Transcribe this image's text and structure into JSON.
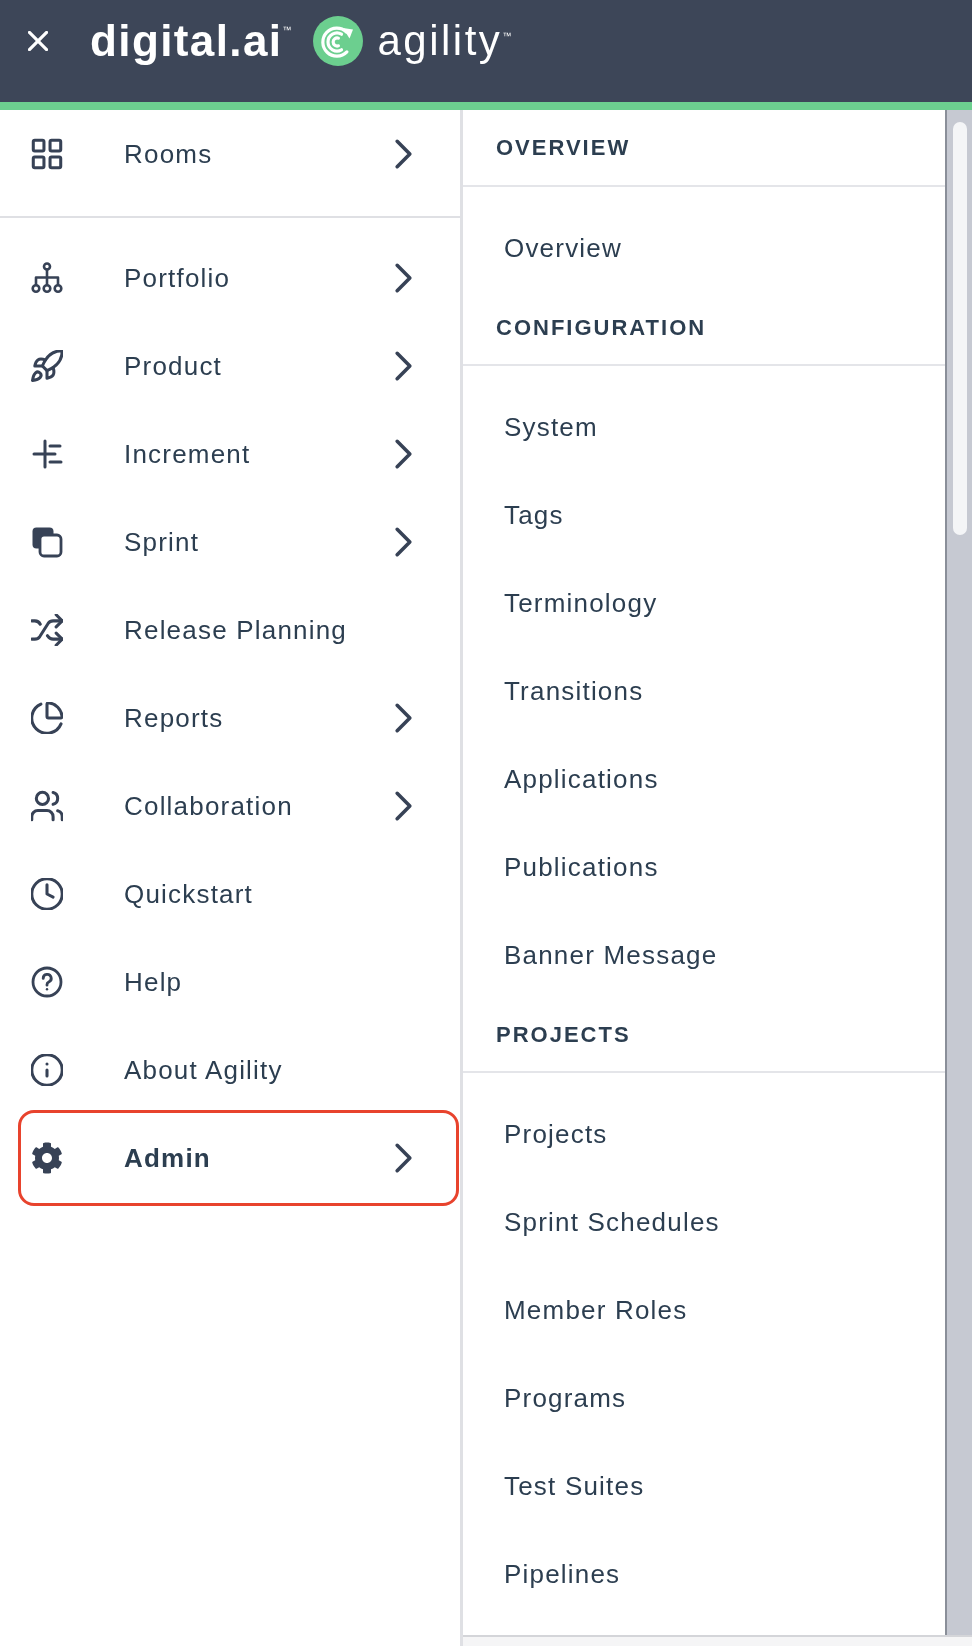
{
  "header": {
    "logo": {
      "brand": "digital.ai",
      "brand_mark": "™",
      "product": "agility",
      "product_mark": "™"
    }
  },
  "sidebar": {
    "sections": [
      {
        "items": [
          {
            "label": "Rooms",
            "has_submenu": true,
            "selected": false
          }
        ]
      },
      {
        "items": [
          {
            "label": "Portfolio",
            "has_submenu": true,
            "selected": false
          },
          {
            "label": "Product",
            "has_submenu": true,
            "selected": false
          },
          {
            "label": "Increment",
            "has_submenu": true,
            "selected": false
          },
          {
            "label": "Sprint",
            "has_submenu": true,
            "selected": false
          },
          {
            "label": "Release Planning",
            "has_submenu": false,
            "selected": false
          },
          {
            "label": "Reports",
            "has_submenu": true,
            "selected": false
          },
          {
            "label": "Collaboration",
            "has_submenu": true,
            "selected": false
          },
          {
            "label": "Quickstart",
            "has_submenu": false,
            "selected": false
          },
          {
            "label": "Help",
            "has_submenu": false,
            "selected": false
          },
          {
            "label": "About Agility",
            "has_submenu": false,
            "selected": false
          },
          {
            "label": "Admin",
            "has_submenu": true,
            "selected": true
          }
        ]
      }
    ]
  },
  "admin_menu": {
    "sections": [
      {
        "heading": "OVERVIEW",
        "items": [
          "Overview"
        ]
      },
      {
        "heading": "CONFIGURATION",
        "items": [
          "System",
          "Tags",
          "Terminology",
          "Transitions",
          "Applications",
          "Publications",
          "Banner Message"
        ]
      },
      {
        "heading": "PROJECTS",
        "items": [
          "Projects",
          "Sprint Schedules",
          "Member Roles",
          "Programs",
          "Test Suites",
          "Pipelines"
        ]
      }
    ]
  }
}
